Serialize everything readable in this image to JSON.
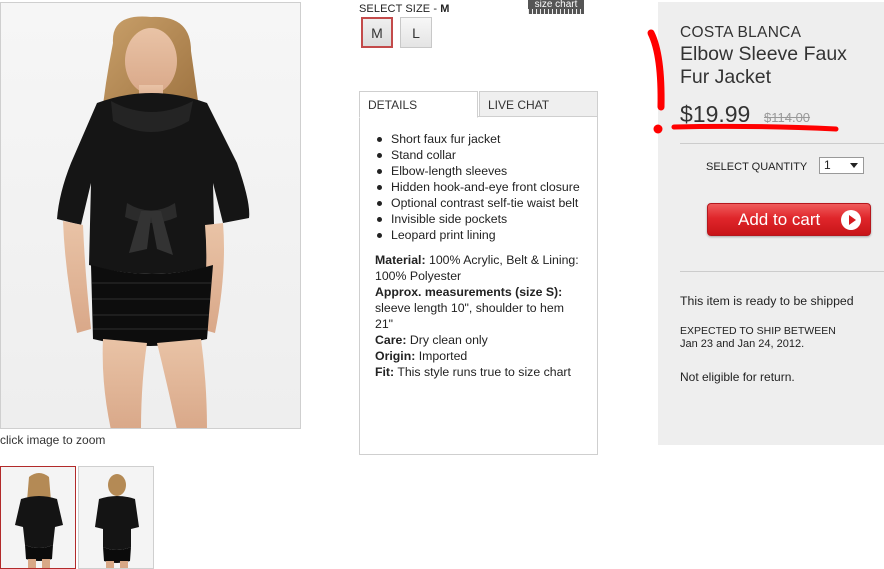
{
  "gallery": {
    "zoom_label": "click image to zoom"
  },
  "size": {
    "label": "SELECT SIZE - ",
    "selected": "M",
    "chart_link": "size chart",
    "options": [
      "M",
      "L"
    ]
  },
  "tabs": {
    "details": "DETAILS",
    "chat": "LIVE CHAT"
  },
  "details": {
    "bullets": [
      "Short faux fur jacket",
      "Stand collar",
      "Elbow-length sleeves",
      "Hidden hook-and-eye front closure",
      "Optional contrast self-tie waist belt",
      "Invisible side pockets",
      "Leopard print lining"
    ],
    "specs": [
      {
        "label": "Material:",
        "value": "100% Acrylic, Belt & Lining: 100% Polyester"
      },
      {
        "label": "Approx. measurements (size S):",
        "value": "sleeve length 10\", shoulder to hem 21\""
      },
      {
        "label": "Care:",
        "value": "Dry clean only"
      },
      {
        "label": "Origin:",
        "value": "Imported"
      },
      {
        "label": "Fit:",
        "value": "This style runs true to size chart"
      }
    ]
  },
  "product": {
    "brand": "COSTA BLANCA",
    "title": "Elbow Sleeve Faux Fur Jacket",
    "price": "$19.99",
    "original_price": "$114.00"
  },
  "purchase": {
    "qty_label": "SELECT QUANTITY",
    "qty_value": "1",
    "add_to_cart": "Add to cart"
  },
  "shipping": {
    "ready": "This item is ready to be shipped",
    "heading": "EXPECTED TO SHIP BETWEEN",
    "dates": "Jan 23 and Jan 24, 2012.",
    "returns": "Not eligible for return."
  },
  "colors": {
    "accent_red": "#e0262b",
    "annotation_red": "#ff0000",
    "panel_bg": "#eeeeee"
  }
}
